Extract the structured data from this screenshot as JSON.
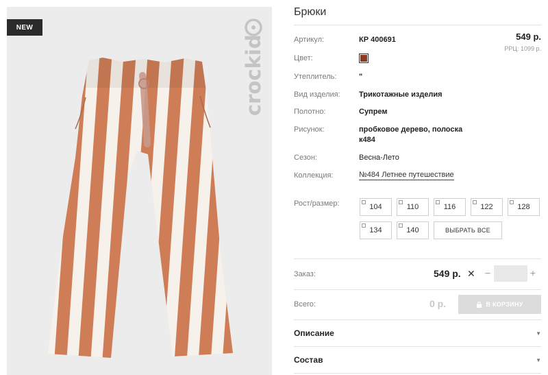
{
  "badge": "NEW",
  "brand": "crockid",
  "product": {
    "title": "Брюки",
    "price": "549 р.",
    "rrp": "РРЦ: 1099 р."
  },
  "attributes": {
    "article_label": "Артикул:",
    "article_value": "КР 400691",
    "color_label": "Цвет:",
    "color_hex": "#8b3a23",
    "insulation_label": "Утеплитель:",
    "insulation_value": "\"",
    "type_label": "Вид изделия:",
    "type_value": "Трикотажные изделия",
    "fabric_label": "Полотно:",
    "fabric_value": "Супрем",
    "pattern_label": "Рисунок:",
    "pattern_value_line1": "пробковое дерево, полоска",
    "pattern_value_line2": "к484",
    "season_label": "Сезон:",
    "season_value": "Весна-Лето",
    "collection_label": "Коллекция:",
    "collection_value": "№484 Летнее путешествие"
  },
  "sizes": {
    "label": "Рост/размер:",
    "options": [
      "104",
      "110",
      "116",
      "122",
      "128",
      "134",
      "140"
    ],
    "select_all": "ВЫБРАТЬ ВСЕ"
  },
  "order": {
    "label": "Заказ:",
    "price": "549 р.",
    "quantity": ""
  },
  "total": {
    "label": "Всего:",
    "value": "0 р.",
    "cart_button": "В КОРЗИНУ"
  },
  "accordions": {
    "description": "Описание",
    "composition": "Состав"
  },
  "colors": {
    "stripe": "#cf7d57",
    "cream": "#f6f1ea",
    "background": "#ececec"
  }
}
